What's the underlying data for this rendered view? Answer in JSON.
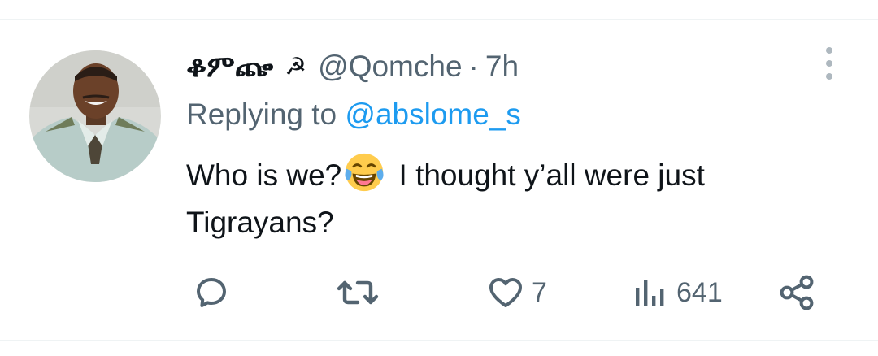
{
  "tweet": {
    "display_name": "ቆምጬ",
    "flag_glyph": "☭",
    "handle": "@Qomche",
    "separator": "·",
    "time": "7h",
    "replying_prefix": "Replying to ",
    "replying_to": "@abslome_s",
    "text_part1": "Who is we?",
    "text_part2": " I thought y’all were just Tigrayans?",
    "emoji": "face-with-tears-of-joy"
  },
  "actions": {
    "reply_count": "",
    "retweet_count": "",
    "like_count": "7",
    "views_count": "641"
  },
  "colors": {
    "primary_text": "#0f1419",
    "secondary_text": "#536471",
    "link": "#1d9bf0",
    "icon": "#536471",
    "divider": "#eff3f4"
  }
}
